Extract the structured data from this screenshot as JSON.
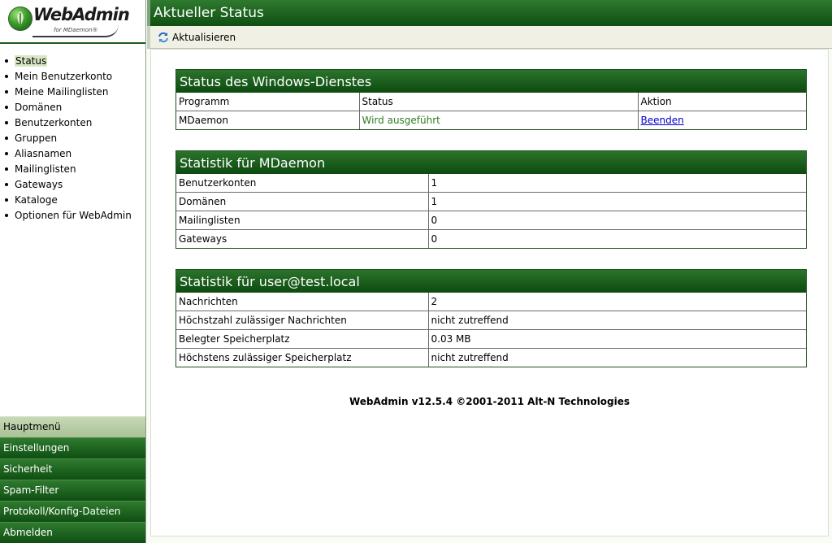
{
  "logo": {
    "brand": "WebAdmin",
    "sub": "for MDaemon®"
  },
  "nav": [
    {
      "label": "Status",
      "active": true
    },
    {
      "label": "Mein Benutzerkonto"
    },
    {
      "label": "Meine Mailinglisten"
    },
    {
      "label": "Domänen"
    },
    {
      "label": "Benutzerkonten"
    },
    {
      "label": "Gruppen"
    },
    {
      "label": "Aliasnamen"
    },
    {
      "label": "Mailinglisten"
    },
    {
      "label": "Gateways"
    },
    {
      "label": "Kataloge"
    },
    {
      "label": "Optionen für WebAdmin"
    }
  ],
  "bottom_menu": [
    {
      "label": "Hauptmenü",
      "active": true
    },
    {
      "label": "Einstellungen"
    },
    {
      "label": "Sicherheit"
    },
    {
      "label": "Spam-Filter"
    },
    {
      "label": "Protokoll/Konfig-Dateien"
    },
    {
      "label": "Abmelden"
    }
  ],
  "page_title": "Aktueller Status",
  "toolbar": {
    "refresh_label": "Aktualisieren",
    "refresh_icon": "refresh-icon"
  },
  "service_panel": {
    "title": "Status des Windows-Dienstes",
    "headers": [
      "Programm",
      "Status",
      "Aktion"
    ],
    "rows": [
      {
        "program": "MDaemon",
        "status": "Wird ausgeführt",
        "action": "Beenden"
      }
    ]
  },
  "mdaemon_stats": {
    "title": "Statistik für MDaemon",
    "rows": [
      {
        "label": "Benutzerkonten",
        "value": "1"
      },
      {
        "label": "Domänen",
        "value": "1"
      },
      {
        "label": "Mailinglisten",
        "value": "0"
      },
      {
        "label": "Gateways",
        "value": "0"
      }
    ]
  },
  "user_stats": {
    "title": "Statistik für user@test.local",
    "rows": [
      {
        "label": "Nachrichten",
        "value": "2"
      },
      {
        "label": "Höchstzahl zulässiger Nachrichten",
        "value": "nicht zutreffend"
      },
      {
        "label": "Belegter Speicherplatz",
        "value": "0.03 MB"
      },
      {
        "label": "Höchstens zulässiger Speicherplatz",
        "value": "nicht zutreffend"
      }
    ]
  },
  "footer": "WebAdmin v12.5.4 ©2001-2011 Alt-N Technologies"
}
